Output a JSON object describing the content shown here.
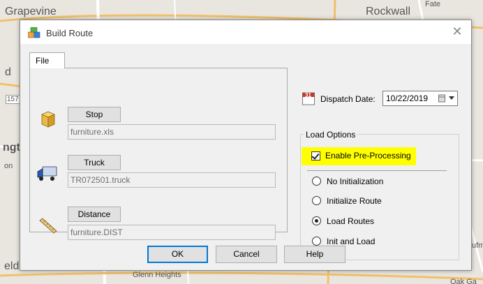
{
  "map": {
    "labels": {
      "grapevine": "Grapevine",
      "rockwall": "Rockwall",
      "fate": "Fate",
      "glenn_heights": "Glenn Heights",
      "edge_d": "d",
      "edge_157": "157",
      "edge_ngt": "ngt",
      "edge_on": "on",
      "edge_eld": "eld",
      "edge_ufm": "ufm",
      "edge_cak": "Oak Ga"
    }
  },
  "dialog": {
    "title": "Build Route",
    "close_symbol": "✕",
    "tab_label": "File",
    "stop": {
      "button_label": "Stop",
      "file": "furniture.xls"
    },
    "truck": {
      "button_label": "Truck",
      "file": "TR072501.truck"
    },
    "distance": {
      "button_label": "Distance",
      "file": "furniture.DIST"
    },
    "calendar_icon_day": "31",
    "dispatch_date_label": "Dispatch Date:",
    "dispatch_date_value": "10/22/2019",
    "load_options": {
      "label": "Load Options",
      "enable_preprocessing": {
        "label": "Enable Pre-Processing",
        "checked": true
      },
      "radios": [
        {
          "label": "No Initialization",
          "selected": false
        },
        {
          "label": "Initialize Route",
          "selected": false
        },
        {
          "label": "Load Routes",
          "selected": true
        },
        {
          "label": "Init and Load",
          "selected": false
        }
      ]
    },
    "buttons": {
      "ok": "OK",
      "cancel": "Cancel",
      "help": "Help"
    }
  },
  "colors": {
    "highlight": "#ffff00",
    "focus_border": "#0078d7",
    "dialog_bg": "#f0f0f0"
  }
}
